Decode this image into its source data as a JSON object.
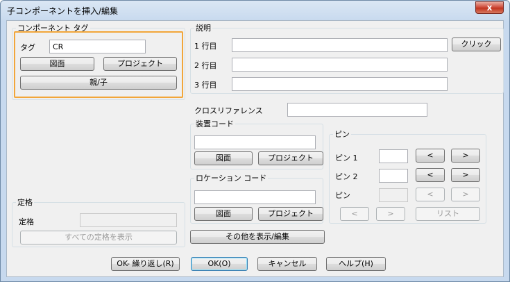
{
  "window": {
    "title": "子コンポーネントを挿入/編集",
    "close_glyph": "x"
  },
  "component_tag": {
    "legend": "コンポーネント タグ",
    "tag_label": "タグ",
    "tag_value": "CR",
    "drawing_button": "図面",
    "project_button": "プロジェクト",
    "parent_child_button": "親/子"
  },
  "description": {
    "legend": "説明",
    "line1_label": "1 行目",
    "line2_label": "2 行目",
    "line3_label": "3 行目",
    "line1_value": "",
    "line2_value": "",
    "line3_value": "",
    "click_button": "クリック"
  },
  "cross_reference": {
    "label": "クロスリファレンス",
    "value": ""
  },
  "device_code": {
    "legend": "装置コード",
    "value": "",
    "drawing_button": "図面",
    "project_button": "プロジェクト"
  },
  "location_code": {
    "legend": "ロケーション コード",
    "value": "",
    "drawing_button": "図面",
    "project_button": "プロジェクト"
  },
  "pins": {
    "legend": "ピン",
    "pin1_label": "ピン 1",
    "pin2_label": "ピン 2",
    "pin_label": "ピン",
    "prev_glyph": "<",
    "next_glyph": ">",
    "list_button": "リスト"
  },
  "rating": {
    "legend": "定格",
    "label": "定格",
    "value": "",
    "show_all_button": "すべての定格を表示"
  },
  "show_more_button": "その他を表示/編集",
  "footer": {
    "ok_repeat": "OK- 繰り返し(R)",
    "ok": "OK(O)",
    "cancel": "キャンセル",
    "help": "ヘルプ(H)"
  },
  "colors": {
    "highlight": "#f2a63a",
    "close_button": "#c2351f"
  }
}
